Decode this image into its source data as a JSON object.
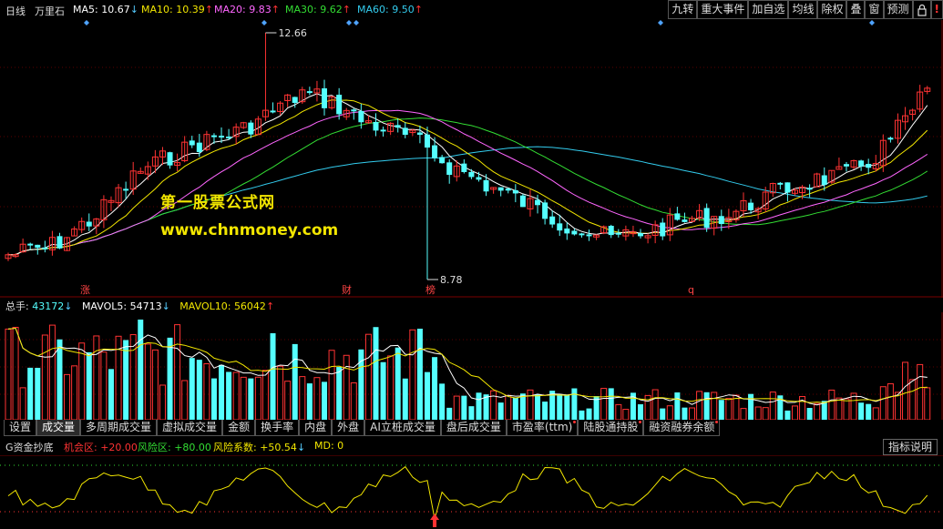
{
  "header": {
    "period": "日线",
    "stock": "万里石",
    "ma5_label": "MA5:",
    "ma5_value": "10.67",
    "ma5_dir": "↓",
    "ma10_label": "MA10:",
    "ma10_value": "10.39",
    "ma10_dir": "↑",
    "ma20_label": "MA20:",
    "ma20_value": "9.83",
    "ma20_dir": "↑",
    "ma30_label": "MA30:",
    "ma30_value": "9.62",
    "ma30_dir": "↑",
    "ma60_label": "MA60:",
    "ma60_value": "9.50",
    "ma60_dir": "↑"
  },
  "toolbar": {
    "jiuzhuan": "九转",
    "events": "重大事件",
    "add_watch": "加自选",
    "avg_line": "均线",
    "exright": "除权",
    "overlay": "叠",
    "window": "窗",
    "forecast": "预测"
  },
  "colors": {
    "ma5": "#ffffff",
    "ma10": "#f2e600",
    "ma20": "#ff66ff",
    "ma30": "#33dd33",
    "ma60": "#33ccee",
    "up": "#ff3333",
    "down": "#55ffff"
  },
  "price_chart": {
    "high_label": "12.66",
    "low_label": "8.78",
    "markers": [
      "涨",
      "财",
      "榜",
      "q"
    ]
  },
  "volume": {
    "total_label": "总手:",
    "total_value": "43172",
    "total_dir": "↓",
    "mavol5_label": "MAVOL5:",
    "mavol5_value": "54713",
    "mavol5_dir": "↓",
    "mavol10_label": "MAVOL10:",
    "mavol10_value": "56042",
    "mavol10_dir": "↑"
  },
  "tabs": [
    "设置",
    "成交量",
    "多周期成交量",
    "虚拟成交量",
    "金额",
    "换手率",
    "内盘",
    "外盘",
    "AI立桩成交量",
    "盘后成交量",
    "市盈率(ttm)",
    "陆股通持股",
    "融资融券余额"
  ],
  "indicator": {
    "name": "G资金抄底",
    "chance_label": "机会区:",
    "chance_value": "+20.00",
    "risk_label": "风险区:",
    "risk_value": "+80.00",
    "coef_label": "风险系数:",
    "coef_value": "+50.54",
    "coef_dir": "↓",
    "md_label": "MD:",
    "md_value": "0",
    "help_button": "指标说明"
  },
  "watermark": {
    "line1": "第一股票公式网",
    "line2": "www.chnmoney.com"
  }
}
